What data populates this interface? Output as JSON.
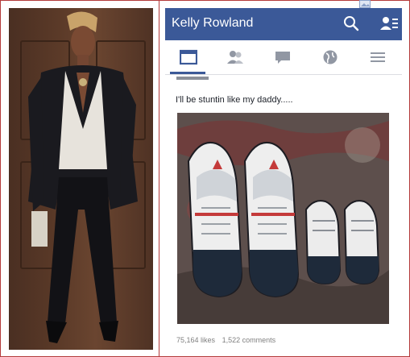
{
  "header": {
    "title": "Kelly Rowland",
    "icons": [
      "search-icon",
      "friend-requests-icon"
    ]
  },
  "tabs": [
    {
      "icon": "news-feed-icon",
      "active": true
    },
    {
      "icon": "friends-icon",
      "active": false
    },
    {
      "icon": "messages-icon",
      "active": false
    },
    {
      "icon": "globe-icon",
      "active": false
    },
    {
      "icon": "menu-icon",
      "active": false
    }
  ],
  "post": {
    "text": "I'll be stuntin like my daddy.....",
    "likes": "75,164 likes",
    "comments": "1,522 comments"
  },
  "colors": {
    "brand": "#3b5998",
    "frame": "#b33a3a"
  }
}
